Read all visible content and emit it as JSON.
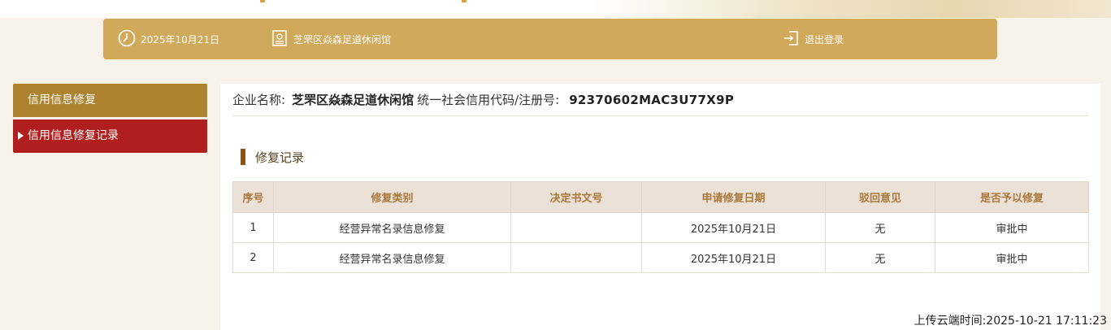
{
  "header": {
    "date": "2025年10月21日",
    "company": "芝罘区焱森足道休闲馆",
    "logout": "退出登录",
    "colors": {
      "header_bg": "#d0a95a",
      "text": "#ffffff"
    }
  },
  "sidebar": {
    "items": [
      {
        "label": "信用信息修复",
        "active": false,
        "color": "#ae8330"
      },
      {
        "label": "信用信息修复记录",
        "active": true,
        "color": "#b01e1e"
      }
    ]
  },
  "company_info": {
    "name_label": "企业名称:",
    "name_value": "芝罘区焱森足道休闲馆",
    "code_label": "统一社会信用代码/注册号:",
    "code_value": "92370602MAC3U77X9P"
  },
  "section": {
    "title": "修复记录"
  },
  "table": {
    "headers": [
      "序号",
      "修复类别",
      "决定书文号",
      "申请修复日期",
      "驳回意见",
      "是否予以修复"
    ],
    "rows": [
      [
        "1",
        "经营异常名录信息修复",
        "",
        "2025年10月21日",
        "无",
        "审批中"
      ],
      [
        "2",
        "经营异常名录信息修复",
        "",
        "2025年10月21日",
        "无",
        "审批中"
      ]
    ]
  },
  "footer": {
    "upload_time": "上传云端时间:2025-10-21 17:11:23"
  },
  "icons": {
    "date": "clock-icon",
    "company": "certificate-icon",
    "logout": "logout-icon"
  }
}
